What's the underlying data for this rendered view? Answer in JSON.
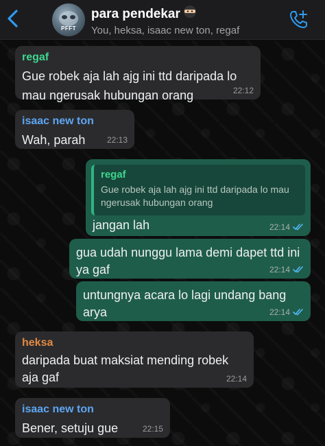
{
  "header": {
    "title": "para pendekar",
    "members": "You, heksa, isaac new ton, regaf",
    "avatar_text": "PFFT"
  },
  "icons": {
    "back": "chevron-left-icon",
    "call": "call-add-icon",
    "ninja": "ninja-emoji-icon",
    "ticks": "double-check-icon"
  },
  "colors": {
    "accent": "#2f9bf0",
    "outgoing_bubble": "#1f5d4b",
    "incoming_bubble": "#2b2b2d",
    "name_regaf": "#3ed68f",
    "name_isaac": "#5da6f2",
    "name_heksa": "#e28a43",
    "read_ticks": "#53b8f5"
  },
  "messages": [
    {
      "sender": "regaf",
      "text": "Gue robek aja lah ajg ini ttd daripada lo mau ngerusak hubungan orang",
      "time": "22:12"
    },
    {
      "sender": "isaac new ton",
      "text": "Wah, parah",
      "time": "22:13"
    },
    {
      "quote_author": "regaf",
      "quote_text": "Gue robek aja lah ajg ini ttd daripada lo mau ngerusak hubungan orang",
      "text": "jangan lah",
      "time": "22:14"
    },
    {
      "text": "gua udah nunggu lama demi dapet ttd ini ya gaf",
      "time": "22:14"
    },
    {
      "text": "untungnya acara lo lagi undang bang arya",
      "time": "22:14"
    },
    {
      "sender": "heksa",
      "text": "daripada buat maksiat mending robek aja gaf",
      "time": "22:14"
    },
    {
      "sender": "isaac new ton",
      "text": "Bener, setuju gue",
      "time": "22:15"
    }
  ]
}
